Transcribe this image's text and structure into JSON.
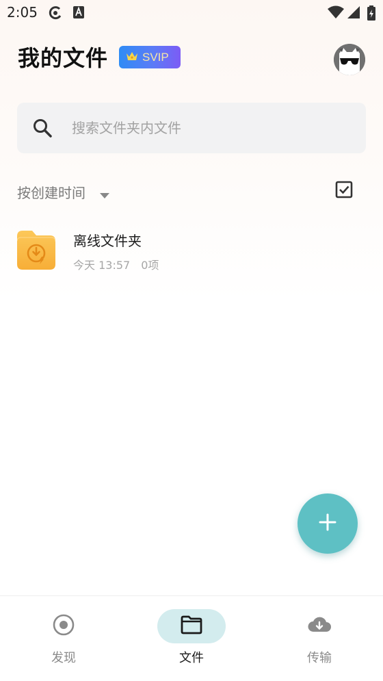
{
  "status_bar": {
    "time": "2:05",
    "icons": [
      "sync-icon",
      "font-a-icon",
      "wifi-icon",
      "signal-icon",
      "battery-icon"
    ]
  },
  "header": {
    "title": "我的文件",
    "badge_label": "SVIP",
    "badge_icon": "crown-icon"
  },
  "search": {
    "placeholder": "搜索文件夹内文件",
    "value": ""
  },
  "sort": {
    "label": "按创建时间",
    "select_icon": "checkbox-select-icon"
  },
  "files": [
    {
      "name": "离线文件夹",
      "date": "今天 13:57",
      "count": "0项",
      "icon": "offline-folder-icon"
    }
  ],
  "fab": {
    "icon": "plus-icon"
  },
  "bottom_nav": {
    "items": [
      {
        "label": "发现",
        "icon": "discover-icon",
        "active": false
      },
      {
        "label": "文件",
        "icon": "folder-icon",
        "active": true
      },
      {
        "label": "传输",
        "icon": "cloud-download-icon",
        "active": false
      }
    ]
  },
  "colors": {
    "accent": "#5ec0c4",
    "active_nav_bg": "#d3ecee",
    "folder": "#fbbd4a",
    "badge_gradient_start": "#2f8cf5",
    "badge_gradient_end": "#7c5cf5"
  }
}
